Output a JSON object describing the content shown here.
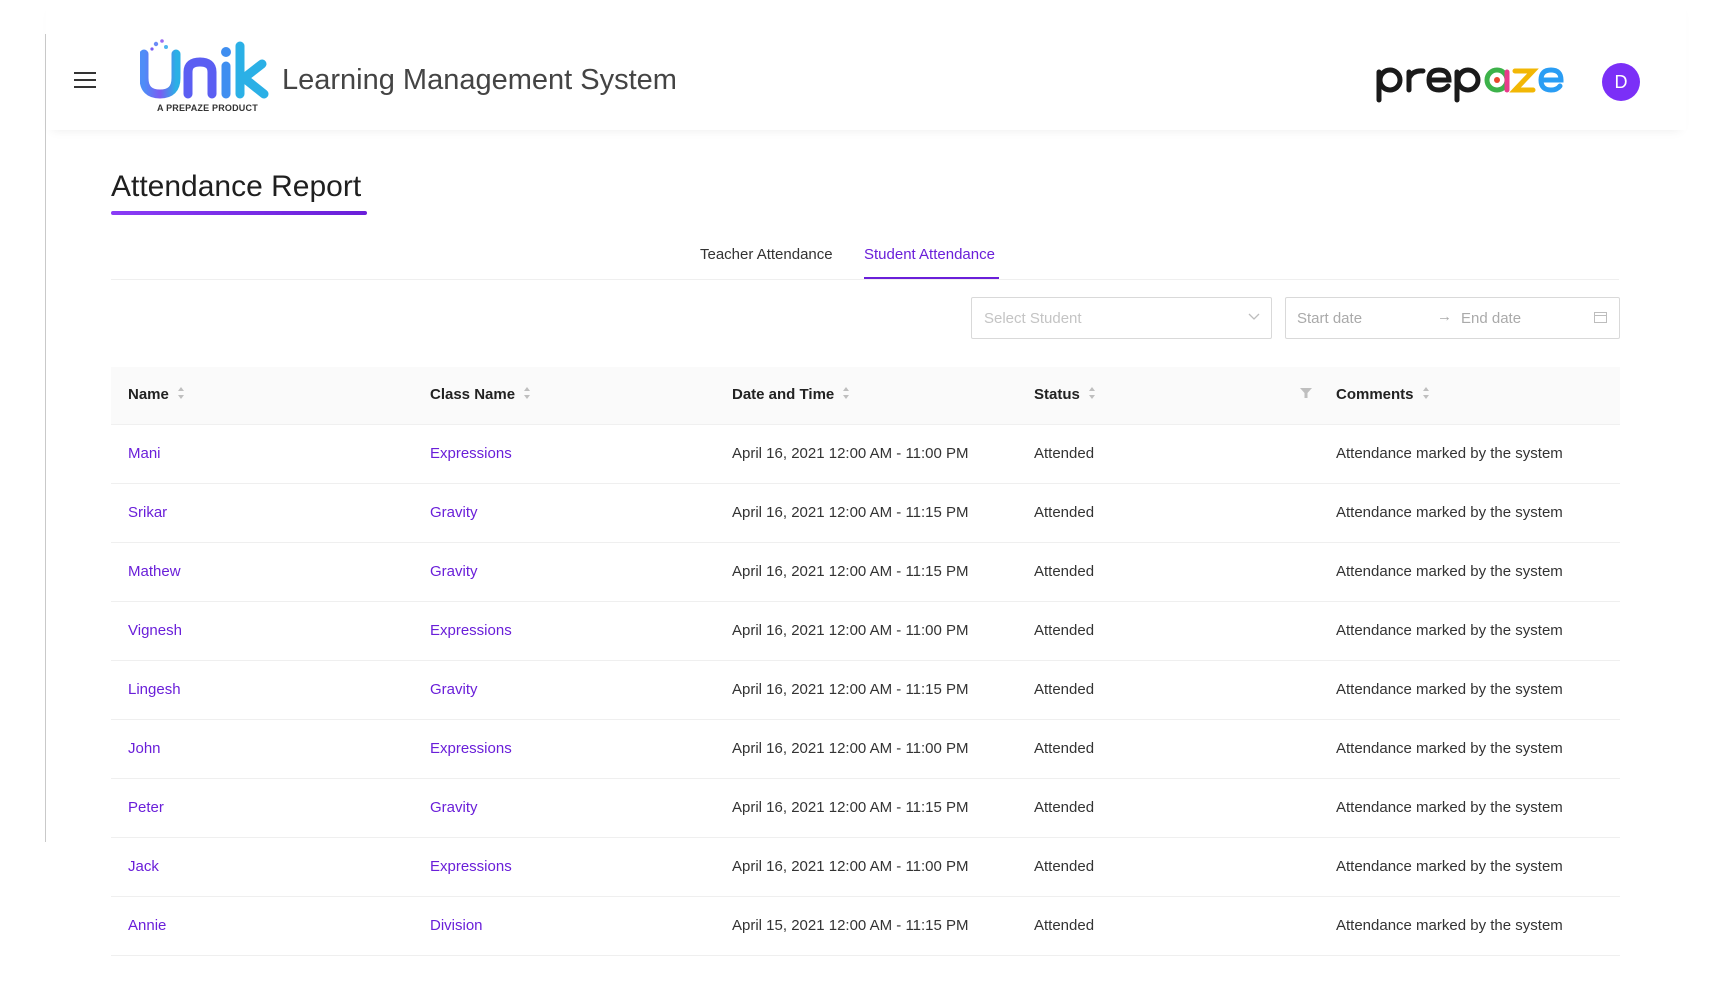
{
  "header": {
    "logo_text": "Unik",
    "logo_tagline": "A PREPAZE PRODUCT",
    "app_title": "Learning Management System",
    "brand_logo_text": "prepaze",
    "avatar_initial": "D"
  },
  "page": {
    "title": "Attendance Report"
  },
  "tabs": [
    {
      "label": "Teacher Attendance",
      "active": false
    },
    {
      "label": "Student Attendance",
      "active": true
    }
  ],
  "filters": {
    "student_select_placeholder": "Select Student",
    "start_date_placeholder": "Start date",
    "end_date_placeholder": "End date"
  },
  "table": {
    "columns": [
      "Name",
      "Class Name",
      "Date and Time",
      "Status",
      "Comments"
    ],
    "rows": [
      {
        "name": "Mani",
        "class": "Expressions",
        "datetime": "April 16, 2021 12:00 AM - 11:00 PM",
        "status": "Attended",
        "comment": "Attendance marked by the system"
      },
      {
        "name": "Srikar",
        "class": "Gravity",
        "datetime": "April 16, 2021 12:00 AM - 11:15 PM",
        "status": "Attended",
        "comment": "Attendance marked by the system"
      },
      {
        "name": "Mathew",
        "class": "Gravity",
        "datetime": "April 16, 2021 12:00 AM - 11:15 PM",
        "status": "Attended",
        "comment": "Attendance marked by the system"
      },
      {
        "name": "Vignesh",
        "class": "Expressions",
        "datetime": "April 16, 2021 12:00 AM - 11:00 PM",
        "status": "Attended",
        "comment": "Attendance marked by the system"
      },
      {
        "name": "Lingesh",
        "class": "Gravity",
        "datetime": "April 16, 2021 12:00 AM - 11:15 PM",
        "status": "Attended",
        "comment": "Attendance marked by the system"
      },
      {
        "name": "John",
        "class": "Expressions",
        "datetime": "April 16, 2021 12:00 AM - 11:00 PM",
        "status": "Attended",
        "comment": "Attendance marked by the system"
      },
      {
        "name": "Peter",
        "class": "Gravity",
        "datetime": "April 16, 2021 12:00 AM - 11:15 PM",
        "status": "Attended",
        "comment": "Attendance marked by the system"
      },
      {
        "name": "Jack",
        "class": "Expressions",
        "datetime": "April 16, 2021 12:00 AM - 11:00 PM",
        "status": "Attended",
        "comment": "Attendance marked by the system"
      },
      {
        "name": "Annie",
        "class": "Division",
        "datetime": "April 15, 2021 12:00 AM - 11:15 PM",
        "status": "Attended",
        "comment": "Attendance marked by the system"
      }
    ]
  },
  "colors": {
    "accent": "#6a1fd9",
    "avatar_bg": "#7b2ff7"
  }
}
